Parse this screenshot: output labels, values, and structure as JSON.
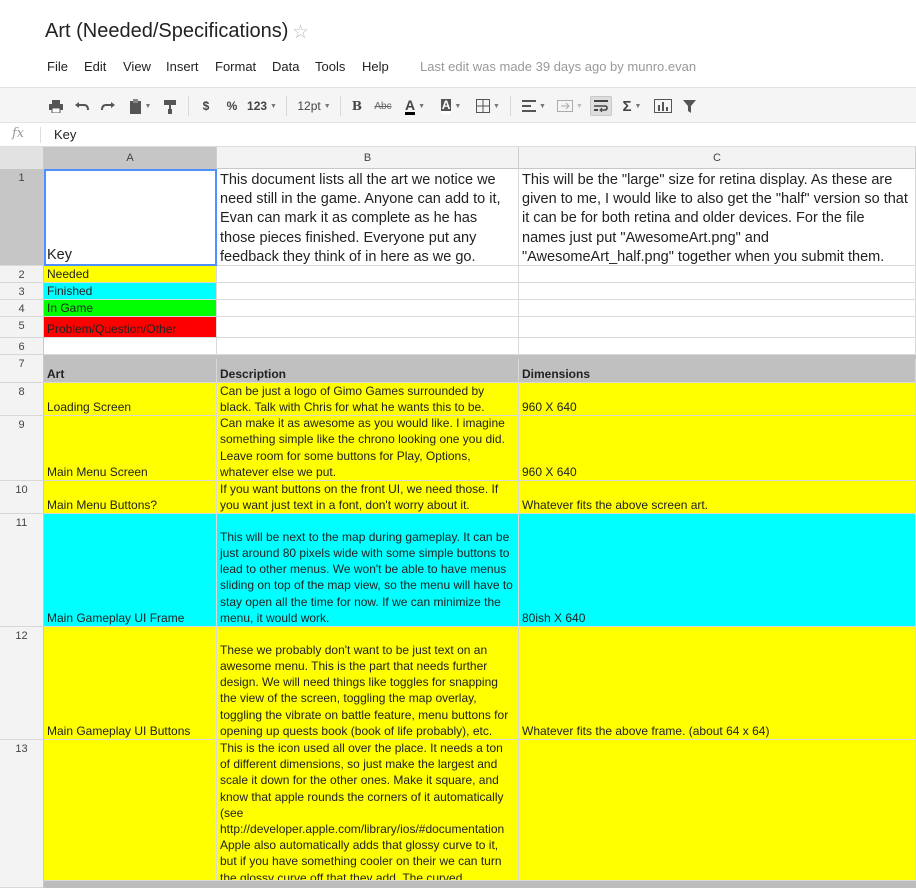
{
  "doc": {
    "title": "Art (Needed/Specifications)",
    "star": "☆",
    "last_edit": "Last edit was made 39 days ago by munro.evan"
  },
  "menu": [
    "File",
    "Edit",
    "View",
    "Insert",
    "Format",
    "Data",
    "Tools",
    "Help"
  ],
  "toolbar": {
    "currency": "$",
    "percent": "%",
    "number_format": "123",
    "font_size": "12pt",
    "bold": "B",
    "strikethrough": "Abc",
    "text_color": "A",
    "fill_color": "A",
    "sum": "Σ"
  },
  "formula_bar": {
    "fx": "fx",
    "value": "Key"
  },
  "columns": [
    "A",
    "B",
    "C"
  ],
  "rows": [
    "1",
    "2",
    "3",
    "4",
    "5",
    "6",
    "7",
    "8",
    "9",
    "10",
    "11",
    "12",
    "13"
  ],
  "cells": {
    "a1": "Key",
    "b1": "This document lists all the art we notice we need still in the game. Anyone can add to it, Evan can mark it as complete as he has those pieces finished. Everyone put any feedback they think of in here as we go.",
    "c1": "This will be the \"large\" size for retina display. As these are given to me, I would like to also get the \"half\" version so that it can be for both retina and older devices. For the file names just put \"AwesomeArt.png\" and \"AwesomeArt_half.png\" together when you submit them.",
    "a2": "Needed",
    "a3": "Finished",
    "a4": "In Game",
    "a5": "Problem/Question/Other",
    "a7": "Art",
    "b7": "Description",
    "c7": "Dimensions",
    "a8": "Loading Screen",
    "b8": "Can be just a logo of Gimo Games surrounded by black. Talk with Chris for what he wants this to be.",
    "c8": "960 X 640",
    "a9": "Main Menu Screen",
    "b9": "Can make it as awesome as you would like. I imagine something simple like the chrono looking one you did. Leave room for some buttons for Play, Options, whatever else we put.",
    "c9": "960 X 640",
    "a10": "Main Menu Buttons?",
    "b10": "If you want buttons on the front UI, we need those. If you want just text in a font, don't worry about it.",
    "c10": "Whatever fits the above screen art.",
    "a11": "Main Gameplay UI Frame",
    "b11": "This will be next to the map during gameplay. It can be just around 80 pixels wide with some simple buttons to lead to other menus. We won't be able to have menus sliding on top of the map view, so the menu will have to stay open all the time for now. If we can minimize the menu, it would work.",
    "c11": "80ish X 640",
    "a12": "Main Gameplay UI Buttons",
    "b12": "These we probably don't want to be just text on an awesome menu. This is the part that needs further design. We will need things like toggles for snapping the view of the screen, toggling the map overlay, toggling the vibrate on battle feature, menu buttons for opening up quests book (book of life probably), etc.",
    "c12": "Whatever fits the above frame. (about 64 x 64)",
    "b13": "This is the icon used all over the place. It needs a ton of different dimensions, so just make the largest and scale it down for the other ones. Make it square, and know that apple rounds the corners of it automatically (see http://developer.apple.com/library/ios/#documentation Apple also automatically adds that glossy curve to it, but if you have something cooler on their we can turn the glossy curve off that they add. The curved"
  },
  "colors": {
    "needed": "#ffff00",
    "finished": "#00ffff",
    "in_game": "#00ff00",
    "problem": "#ff0000",
    "header_row": "#c0c0c0",
    "selection": "#4d90fe"
  }
}
